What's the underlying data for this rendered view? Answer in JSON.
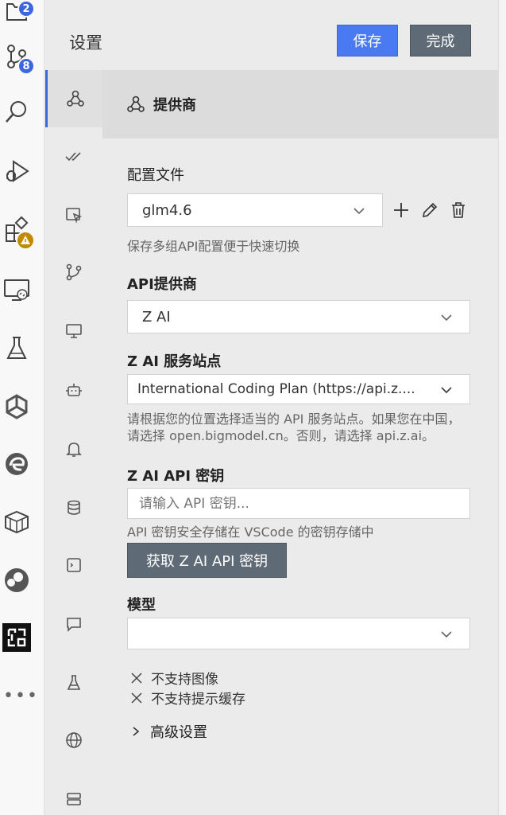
{
  "activity_bar": {
    "explorer_badge": "2",
    "source_control_badge": "8",
    "more_label": "•••"
  },
  "settings": {
    "title": "设置",
    "save_label": "保存",
    "done_label": "完成",
    "section_title": "提供商",
    "profile": {
      "label": "配置文件",
      "value": "glm4.6",
      "help": "保存多组API配置便于快速切换"
    },
    "provider": {
      "label": "API提供商",
      "value": "Z AI"
    },
    "endpoint": {
      "label": "Z AI 服务站点",
      "value": "International Coding Plan (https://api.z....",
      "help": "请根据您的位置选择适当的 API 服务站点。如果您在中国，请选择 open.bigmodel.cn。否则，请选择 api.z.ai。"
    },
    "api_key": {
      "label": "Z AI API 密钥",
      "placeholder": "请输入 API 密钥...",
      "help": "API 密钥安全存储在 VSCode 的密钥存储中",
      "get_key_label": "获取 Z AI API 密钥"
    },
    "model": {
      "label": "模型",
      "value": ""
    },
    "capabilities": [
      "不支持图像",
      "不支持提示缓存"
    ],
    "advanced_label": "高级设置"
  },
  "colors": {
    "accent": "#4a7af2",
    "secondary_button": "#5e6a76",
    "badge": "#3b66e0",
    "warning": "#c28a00"
  }
}
